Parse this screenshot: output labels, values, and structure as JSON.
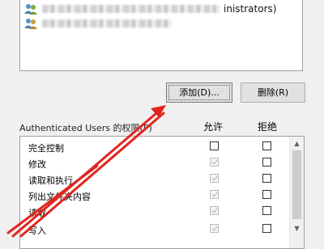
{
  "users": {
    "rows": [
      {
        "name_suffix": "inistrators)"
      },
      {
        "name_suffix": ""
      }
    ]
  },
  "buttons": {
    "add_label": "添加(D)...",
    "remove_label": "删除(R)"
  },
  "permissions": {
    "title": "Authenticated Users 的权限(P)",
    "allow_header": "允许",
    "deny_header": "拒绝",
    "rows": [
      {
        "name": "完全控制",
        "allow": false,
        "deny": false,
        "allow_disabled": false
      },
      {
        "name": "修改",
        "allow": true,
        "deny": false,
        "allow_disabled": true
      },
      {
        "name": "读取和执行",
        "allow": true,
        "deny": false,
        "allow_disabled": true
      },
      {
        "name": "列出文件夹内容",
        "allow": true,
        "deny": false,
        "allow_disabled": true
      },
      {
        "name": "读取",
        "allow": true,
        "deny": false,
        "allow_disabled": true
      },
      {
        "name": "写入",
        "allow": true,
        "deny": false,
        "allow_disabled": true
      }
    ]
  },
  "colors": {
    "annotation_arrow": "#e0261f",
    "button_face": "#e1e1e1",
    "window_bg": "#f0f0f0"
  },
  "icons": [
    "user-group-icon",
    "scroll-up-icon",
    "scroll-down-icon"
  ]
}
